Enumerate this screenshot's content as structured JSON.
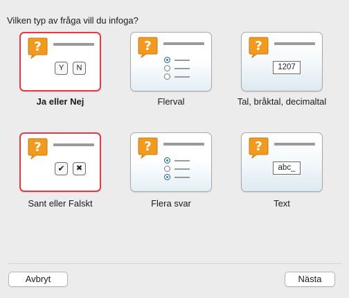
{
  "dialog": {
    "prompt": "Vilken typ av fråga vill du infoga?"
  },
  "question_types": [
    {
      "label": "Ja eller Nej",
      "selected": true,
      "icon": "yes-no-icon",
      "yes_key": "Y",
      "no_key": "N"
    },
    {
      "label": "Flerval",
      "selected": false,
      "icon": "multiple-choice-icon"
    },
    {
      "label": "Tal, bråktal, decimaltal",
      "selected": false,
      "icon": "number-field-icon",
      "sample": "1207"
    },
    {
      "label": "Sant eller Falskt",
      "selected": true,
      "icon": "true-false-icon",
      "true_mark": "✔",
      "false_mark": "✖"
    },
    {
      "label": "Flera svar",
      "selected": false,
      "icon": "multiple-answers-icon"
    },
    {
      "label": "Text",
      "selected": false,
      "icon": "text-field-icon",
      "sample": "abc_"
    }
  ],
  "buttons": {
    "cancel": "Avbryt",
    "next": "Nästa"
  },
  "colors": {
    "selection_border": "#e43a45",
    "question_icon": "#f29a1d",
    "radio_selected": "#2f78c4",
    "window_background": "#ececec"
  }
}
